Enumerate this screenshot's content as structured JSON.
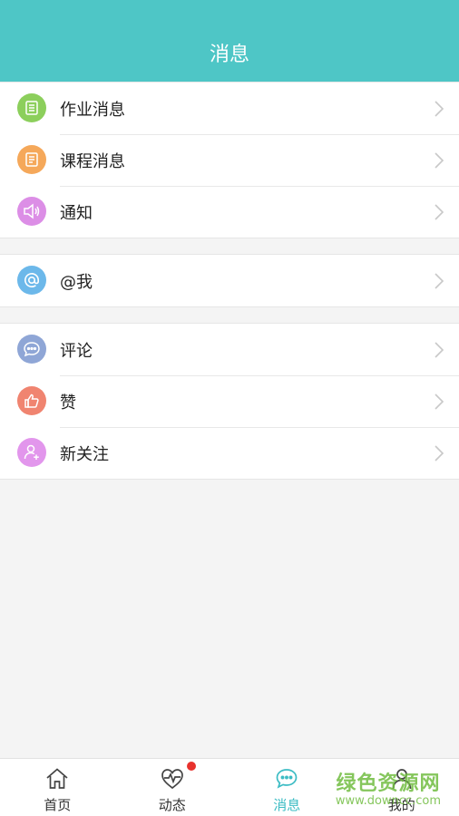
{
  "header": {
    "title": "消息"
  },
  "groups": [
    {
      "items": [
        {
          "label": "作业消息",
          "icon": "homework-list-icon",
          "color": "#8ccf5c"
        },
        {
          "label": "课程消息",
          "icon": "course-document-icon",
          "color": "#f5a85a"
        },
        {
          "label": "通知",
          "icon": "speaker-icon",
          "color": "#dc8ee6"
        }
      ]
    },
    {
      "items": [
        {
          "label": "@我",
          "icon": "at-icon",
          "color": "#6cb8ea"
        }
      ]
    },
    {
      "items": [
        {
          "label": "评论",
          "icon": "comment-icon",
          "color": "#8fa6d6"
        },
        {
          "label": "赞",
          "icon": "thumbs-up-icon",
          "color": "#f08470"
        },
        {
          "label": "新关注",
          "icon": "add-user-icon",
          "color": "#e296ec"
        }
      ]
    }
  ],
  "tabbar": {
    "tabs": [
      {
        "label": "首页",
        "icon": "home-icon",
        "active": false
      },
      {
        "label": "动态",
        "icon": "heartbeat-icon",
        "active": false,
        "badge": true
      },
      {
        "label": "消息",
        "icon": "chat-bubble-icon",
        "active": true
      },
      {
        "label": "我的",
        "icon": "user-icon",
        "active": false
      }
    ],
    "active_color": "#3cbcc4",
    "badge_color": "#e8322d"
  },
  "watermark": {
    "main": "绿色资源网",
    "sub": "www.downcc.com"
  }
}
